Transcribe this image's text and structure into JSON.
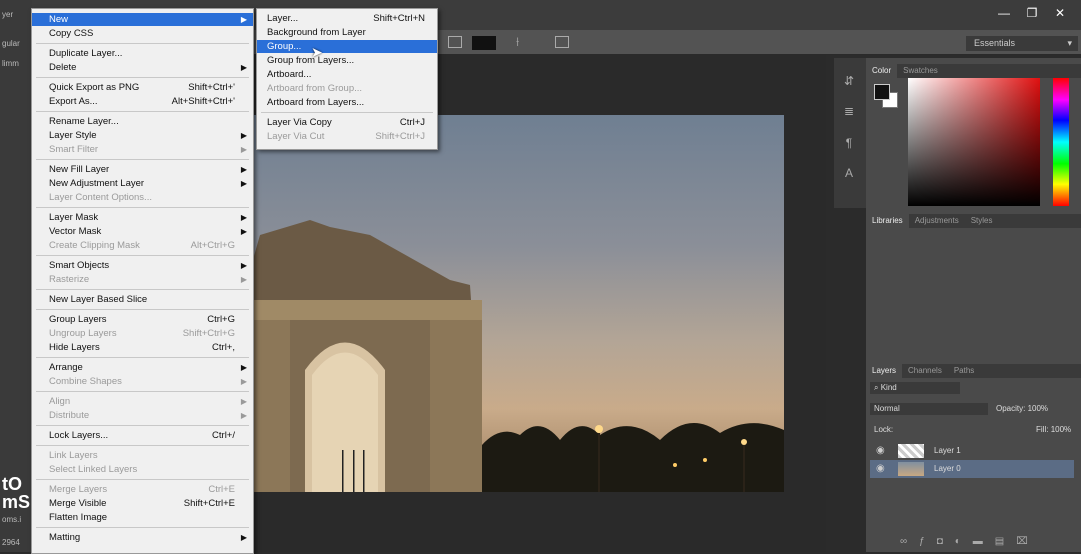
{
  "window": {
    "workspace": "Essentials",
    "controls": [
      "—",
      "❐",
      "✕"
    ]
  },
  "left_panel": {
    "tab_fragment": "yer",
    "option_fragment": "gular",
    "trim_fragment": "limm",
    "large_text_1": "tO",
    "large_text_2": "mS",
    "small_text": "oms.i",
    "bottom_text": "2964"
  },
  "main_menu": {
    "items": [
      {
        "label": "New",
        "shortcut": "",
        "submenu": true,
        "state": "highlight"
      },
      {
        "label": "Copy CSS",
        "shortcut": "",
        "submenu": false,
        "state": "normal"
      },
      {
        "label": "Duplicate Layer...",
        "shortcut": "",
        "submenu": false,
        "state": "normal"
      },
      {
        "label": "Delete",
        "shortcut": "",
        "submenu": true,
        "state": "normal"
      },
      {
        "label": "Quick Export as PNG",
        "shortcut": "Shift+Ctrl+'",
        "submenu": false,
        "state": "normal"
      },
      {
        "label": "Export As...",
        "shortcut": "Alt+Shift+Ctrl+'",
        "submenu": false,
        "state": "normal"
      },
      {
        "label": "Rename Layer...",
        "shortcut": "",
        "submenu": false,
        "state": "normal"
      },
      {
        "label": "Layer Style",
        "shortcut": "",
        "submenu": true,
        "state": "normal"
      },
      {
        "label": "Smart Filter",
        "shortcut": "",
        "submenu": true,
        "state": "disabled"
      },
      {
        "label": "New Fill Layer",
        "shortcut": "",
        "submenu": true,
        "state": "normal"
      },
      {
        "label": "New Adjustment Layer",
        "shortcut": "",
        "submenu": true,
        "state": "normal"
      },
      {
        "label": "Layer Content Options...",
        "shortcut": "",
        "submenu": false,
        "state": "disabled"
      },
      {
        "label": "Layer Mask",
        "shortcut": "",
        "submenu": true,
        "state": "normal"
      },
      {
        "label": "Vector Mask",
        "shortcut": "",
        "submenu": true,
        "state": "normal"
      },
      {
        "label": "Create Clipping Mask",
        "shortcut": "Alt+Ctrl+G",
        "submenu": false,
        "state": "disabled"
      },
      {
        "label": "Smart Objects",
        "shortcut": "",
        "submenu": true,
        "state": "normal"
      },
      {
        "label": "Rasterize",
        "shortcut": "",
        "submenu": true,
        "state": "disabled"
      },
      {
        "label": "New Layer Based Slice",
        "shortcut": "",
        "submenu": false,
        "state": "normal"
      },
      {
        "label": "Group Layers",
        "shortcut": "Ctrl+G",
        "submenu": false,
        "state": "normal"
      },
      {
        "label": "Ungroup Layers",
        "shortcut": "Shift+Ctrl+G",
        "submenu": false,
        "state": "disabled"
      },
      {
        "label": "Hide Layers",
        "shortcut": "Ctrl+,",
        "submenu": false,
        "state": "normal"
      },
      {
        "label": "Arrange",
        "shortcut": "",
        "submenu": true,
        "state": "normal"
      },
      {
        "label": "Combine Shapes",
        "shortcut": "",
        "submenu": true,
        "state": "disabled"
      },
      {
        "label": "Align",
        "shortcut": "",
        "submenu": true,
        "state": "disabled"
      },
      {
        "label": "Distribute",
        "shortcut": "",
        "submenu": true,
        "state": "disabled"
      },
      {
        "label": "Lock Layers...",
        "shortcut": "Ctrl+/",
        "submenu": false,
        "state": "normal"
      },
      {
        "label": "Link Layers",
        "shortcut": "",
        "submenu": false,
        "state": "disabled"
      },
      {
        "label": "Select Linked Layers",
        "shortcut": "",
        "submenu": false,
        "state": "disabled"
      },
      {
        "label": "Merge Layers",
        "shortcut": "Ctrl+E",
        "submenu": false,
        "state": "disabled"
      },
      {
        "label": "Merge Visible",
        "shortcut": "Shift+Ctrl+E",
        "submenu": false,
        "state": "normal"
      },
      {
        "label": "Flatten Image",
        "shortcut": "",
        "submenu": false,
        "state": "normal"
      },
      {
        "label": "Matting",
        "shortcut": "",
        "submenu": true,
        "state": "normal"
      }
    ]
  },
  "sub_menu": {
    "items": [
      {
        "label": "Layer...",
        "shortcut": "Shift+Ctrl+N",
        "state": "normal"
      },
      {
        "label": "Background from Layer",
        "shortcut": "",
        "state": "normal"
      },
      {
        "label": "Group...",
        "shortcut": "",
        "state": "highlight"
      },
      {
        "label": "Group from Layers...",
        "shortcut": "",
        "state": "normal"
      },
      {
        "label": "Artboard...",
        "shortcut": "",
        "state": "normal"
      },
      {
        "label": "Artboard from Group...",
        "shortcut": "",
        "state": "disabled"
      },
      {
        "label": "Artboard from Layers...",
        "shortcut": "",
        "state": "normal"
      },
      {
        "label": "Layer Via Copy",
        "shortcut": "Ctrl+J",
        "state": "normal"
      },
      {
        "label": "Layer Via Cut",
        "shortcut": "Shift+Ctrl+J",
        "state": "disabled"
      }
    ]
  },
  "color_panel": {
    "tabs": [
      "Color",
      "Swatches"
    ]
  },
  "libraries_panel": {
    "tabs": [
      "Libraries",
      "Adjustments",
      "Styles"
    ]
  },
  "layers_panel": {
    "tabs": [
      "Layers",
      "Channels",
      "Paths"
    ],
    "filter_label": "Kind",
    "blend_mode": "Normal",
    "opacity_label": "Opacity:",
    "opacity_value": "100%",
    "lock_label": "Lock:",
    "fill_label": "Fill:",
    "fill_value": "100%",
    "layers": [
      {
        "name": "Layer 1",
        "selected": false
      },
      {
        "name": "Layer 0",
        "selected": true
      }
    ]
  },
  "colors": {
    "highlight": "#2a6fd8",
    "menu_bg": "#f0f0f0",
    "panel_bg": "#4a4a4a"
  }
}
